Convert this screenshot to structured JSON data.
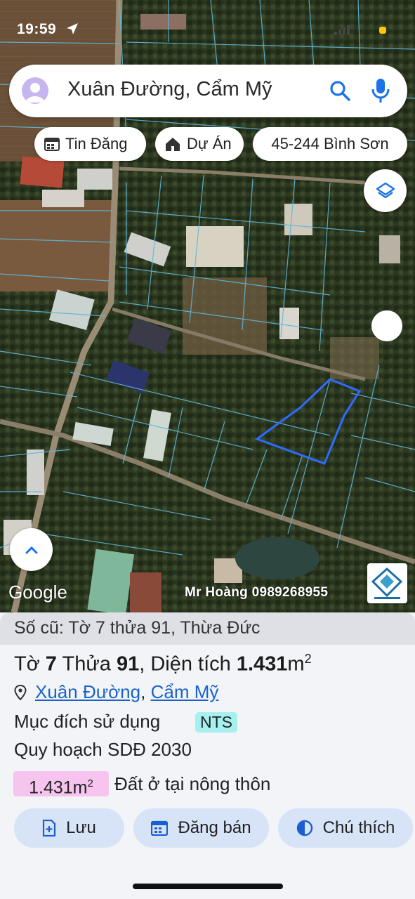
{
  "status_bar": {
    "time": "19:59"
  },
  "search": {
    "query": "Xuân Đường, Cẩm Mỹ"
  },
  "chips": [
    {
      "label": "Tin Đăng",
      "icon": "calendar-icon"
    },
    {
      "label": "Dự Án",
      "icon": "house-icon"
    },
    {
      "label": "45-244 Bình Sơn",
      "icon": ""
    }
  ],
  "map": {
    "google_label": "Google",
    "watermark": "Mr Hoàng 0989268955",
    "parcel_outline_color": "#2d6cff",
    "boundary_color": "#5fb6d8"
  },
  "sheet": {
    "old_info": "Số cũ: Tờ 7 thửa 91, Thừa Đức",
    "title": {
      "sheet_label": "Tờ",
      "sheet_no": "7",
      "parcel_label": "Thửa",
      "parcel_no": "91",
      "area_label": ", Diện tích",
      "area_value": "1.431",
      "area_unit": "m",
      "area_exp": "2"
    },
    "address": {
      "commune": "Xuân Đường",
      "separator": ",",
      "district": "Cẩm Mỹ"
    },
    "purpose": {
      "label": "Mục đích sử dụng",
      "code": "NTS"
    },
    "plan": "Quy hoạch SDĐ 2030",
    "zoning": {
      "area": "1.431m",
      "area_exp": "2",
      "type": "Đất ở tại nông thôn",
      "color": "#f6c4ee"
    },
    "actions": [
      {
        "label": "Lưu",
        "icon": "save-plus-icon"
      },
      {
        "label": "Đăng bán",
        "icon": "calendar-icon"
      },
      {
        "label": "Chú thích",
        "icon": "contrast-icon"
      }
    ]
  }
}
